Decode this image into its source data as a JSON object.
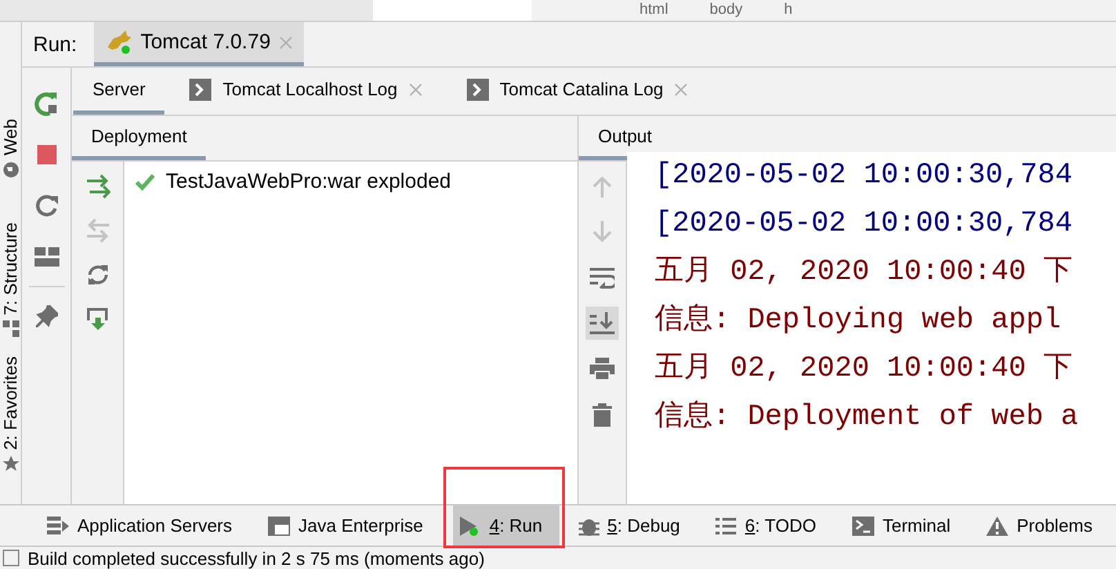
{
  "breadcrumb": [
    "html",
    "body",
    "h"
  ],
  "side_tabs": [
    {
      "label": "Web",
      "kind": "globe"
    },
    {
      "label": "7: Structure",
      "kind": "structure"
    },
    {
      "label": "2: Favorites",
      "kind": "star"
    }
  ],
  "run": {
    "label": "Run:",
    "tabs": [
      {
        "label": "Tomcat 7.0.79",
        "selected": true,
        "running": true
      }
    ]
  },
  "run_toolbar": [
    {
      "kind": "rerun"
    },
    {
      "kind": "stop"
    },
    {
      "kind": "restart"
    },
    {
      "kind": "layout"
    },
    {
      "kind": "pin"
    }
  ],
  "server_tabs": [
    {
      "label": "Server",
      "selected": true,
      "closable": false,
      "log": false
    },
    {
      "label": "Tomcat Localhost Log",
      "selected": false,
      "closable": true,
      "log": true
    },
    {
      "label": "Tomcat Catalina Log",
      "selected": false,
      "closable": true,
      "log": true
    }
  ],
  "deployment": {
    "title": "Deployment",
    "toolbar": [
      {
        "kind": "deploy",
        "disabled": false
      },
      {
        "kind": "undeploy",
        "disabled": true
      },
      {
        "kind": "refresh",
        "disabled": false
      },
      {
        "kind": "deploy-all",
        "disabled": false
      }
    ],
    "artifacts": [
      {
        "name": "TestJavaWebPro:war exploded",
        "deployed": true
      }
    ]
  },
  "output": {
    "title": "Output",
    "toolbar": [
      {
        "kind": "up",
        "disabled": true,
        "selected": false
      },
      {
        "kind": "down",
        "disabled": true,
        "selected": false
      },
      {
        "kind": "wrap",
        "disabled": false,
        "selected": false
      },
      {
        "kind": "scroll-end",
        "disabled": false,
        "selected": true
      },
      {
        "kind": "print",
        "disabled": false,
        "selected": false
      },
      {
        "kind": "delete",
        "disabled": false,
        "selected": false
      }
    ],
    "lines": [
      {
        "text": "[2020-05-02 10:00:30,784",
        "kind": "stdout"
      },
      {
        "text": "[2020-05-02 10:00:30,784",
        "kind": "stdout"
      },
      {
        "text": "五月 02, 2020 10:00:40 下",
        "kind": "stderr"
      },
      {
        "text": "信息: Deploying web appl",
        "kind": "stderr"
      },
      {
        "text": "五月 02, 2020 10:00:40 下",
        "kind": "stderr"
      },
      {
        "text": "信息: Deployment of web a",
        "kind": "stderr"
      }
    ]
  },
  "tool_windows": [
    {
      "label": "Application Servers",
      "kind": "servers",
      "selected": false,
      "highlighted": false
    },
    {
      "label": "Java Enterprise",
      "kind": "enterprise",
      "selected": false,
      "highlighted": false
    },
    {
      "key": "4",
      "label": ": Run",
      "kind": "run",
      "selected": true,
      "highlighted": true
    },
    {
      "key": "5",
      "label": ": Debug",
      "kind": "bug",
      "selected": false,
      "highlighted": false
    },
    {
      "key": "6",
      "label": ": TODO",
      "kind": "list",
      "selected": false,
      "highlighted": false
    },
    {
      "label": "Terminal",
      "kind": "terminal",
      "selected": false,
      "highlighted": false
    },
    {
      "label": "Problems",
      "kind": "warning",
      "selected": false,
      "highlighted": false
    }
  ],
  "status_bar": {
    "text": "Build completed successfully in 2 s 75 ms (moments ago)"
  }
}
